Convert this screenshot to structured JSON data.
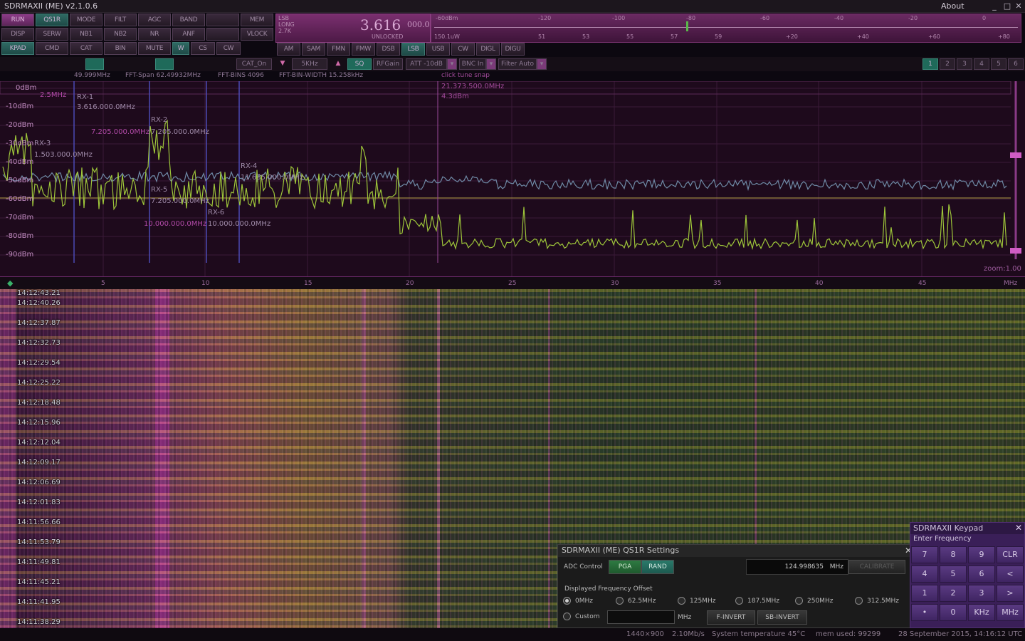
{
  "window": {
    "title": "SDRMAXII (ME) v2.1.0.6",
    "about": "About",
    "min": "_",
    "max": "□",
    "close": "✕"
  },
  "buttons": {
    "row1": [
      "RUN",
      "QS1R",
      "MODE",
      "FILT",
      "AGC",
      "BAND",
      "",
      "MEM"
    ],
    "row2": [
      "DISP",
      "SERW",
      "NB1",
      "NB2",
      "NR",
      "ANF",
      "",
      "VLOCK"
    ],
    "row3": [
      "KPAD",
      "CMD",
      "CAT",
      "BIN",
      "MUTE",
      "W",
      "CS",
      "CW"
    ]
  },
  "vfo": {
    "mode_info": "LSB\nLONG\n2.7K",
    "frequency": "3.616",
    "frequency_sub": "000.0",
    "lock_status": "UNLOCKED"
  },
  "smeter": {
    "top_ticks": [
      "-60dBm",
      "-120",
      "-100",
      "-80",
      "-60",
      "-40",
      "-20",
      "0"
    ],
    "bottom_ticks": [
      "150.1uW",
      "51",
      "53",
      "55",
      "57",
      "59",
      "+20",
      "+40",
      "+60",
      "+80"
    ]
  },
  "modes": {
    "items": [
      "AM",
      "SAM",
      "FMN",
      "FMW",
      "DSB",
      "LSB",
      "USB",
      "CW",
      "DIGL",
      "DIGU"
    ],
    "active": "LSB"
  },
  "toolbar": {
    "cat": "CAT_On",
    "step": "5KHz",
    "sq": "SQ",
    "rfgain": "RFGain",
    "att": "ATT -10dB",
    "bnc": "BNC In",
    "filter": "Filter Auto",
    "rx_tabs": [
      "1",
      "2",
      "3",
      "4",
      "5",
      "6"
    ]
  },
  "info": {
    "center": "49.999MHz",
    "span": "FFT-Span 62.49932MHz",
    "bins": "FFT-BINS 4096",
    "binwidth": "FFT-BIN-WIDTH 15.258kHz",
    "click_tune": "click tune snap",
    "cursor_freq": "21.373.500.0MHz",
    "cursor_db": "4.3dBm"
  },
  "spectrum": {
    "db_labels": [
      "0dBm",
      "-10dBm",
      "-20dBm",
      "-30dBm",
      "-40dBm",
      "-50dBm",
      "-60dBm",
      "-70dBm",
      "-80dBm",
      "-90dBm"
    ],
    "zoom": "zoom:1.00",
    "rx_labels": [
      {
        "name": "RX-1",
        "freq": "3.616.000.0MHz",
        "extra": "2.5MHz"
      },
      {
        "name": "RX-2",
        "freq": "7.205.000.0MHz",
        "extra": "7.205.000.0MHz"
      },
      {
        "name": "RX-3",
        "freq": "1.503.000.0MHz",
        "extra": ""
      },
      {
        "name": "RX-4",
        "freq": "11.635.000.0MHz",
        "extra": ""
      },
      {
        "name": "RX-5",
        "freq": "7.205.000.0MHz",
        "extra": ""
      },
      {
        "name": "RX-6",
        "freq": "10.000.000.0MHz",
        "extra": "10.000.000.0MHz"
      }
    ]
  },
  "freq_scale": {
    "ticks": [
      "5",
      "10",
      "15",
      "20",
      "25",
      "30",
      "35",
      "40",
      "45"
    ],
    "unit": "MHz"
  },
  "waterfall": {
    "timestamps": [
      "14:12:43.21",
      "14:12:40.26",
      "14:12:37.87",
      "14:12:32.73",
      "14:12:29.54",
      "14:12:25.22",
      "14:12:18.48",
      "14:12:15.96",
      "14:12:12.04",
      "14:12:09.17",
      "14:12:06.69",
      "14:12:01.83",
      "14:11:56.66",
      "14:11:53.79",
      "14:11:49.81",
      "14:11:45.21",
      "14:11:41.95",
      "14:11:38.29"
    ]
  },
  "status": {
    "resolution": "1440×900",
    "rate": "2.10Mb/s",
    "temp": "System temperature 45°C",
    "mem": "mem used: 99299",
    "date": "28 September 2015, 14:16:12 UTC"
  },
  "qs1r": {
    "title": "SDRMAXII (ME) QS1R Settings",
    "adc_label": "ADC Control",
    "pga": "PGA",
    "rand": "RAND",
    "freq_value": "124.998635",
    "freq_unit": "MHz",
    "calibrate": "CALIBRATE",
    "offset_label": "Displayed Frequency Offset",
    "offsets": [
      "0MHz",
      "62.5MHz",
      "125MHz",
      "187.5MHz",
      "250MHz",
      "312.5MHz"
    ],
    "custom": "Custom",
    "custom_unit": "MHz",
    "finvert": "F-INVERT",
    "sbinvert": "SB-INVERT"
  },
  "keypad": {
    "title": "SDRMAXII Keypad",
    "subtitle": "Enter Frequency",
    "keys": [
      "7",
      "8",
      "9",
      "CLR",
      "4",
      "5",
      "6",
      "<",
      "1",
      "2",
      "3",
      ">",
      "•",
      "0",
      "KHz",
      "MHz"
    ]
  }
}
